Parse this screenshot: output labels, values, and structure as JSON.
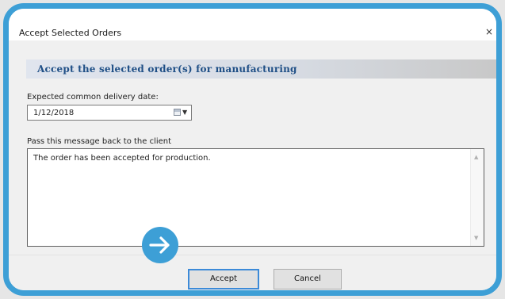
{
  "window": {
    "title": "Accept Selected Orders",
    "close_glyph": "×"
  },
  "banner": {
    "text": "Accept the selected order(s) for manufacturing"
  },
  "delivery": {
    "label": "Expected common delivery date:",
    "value": "1/12/2018",
    "picker_icon": "calendar-icon"
  },
  "message": {
    "label": "Pass this message back to the client",
    "value": "The order has been accepted for production."
  },
  "buttons": {
    "accept": "Accept",
    "cancel": "Cancel"
  },
  "annotation": {
    "icon": "arrow-right-icon",
    "color": "#3d9fd6"
  },
  "colors": {
    "frame": "#3d9fd6",
    "banner_text": "#1f4f86",
    "default_button_border": "#3c8ad8"
  }
}
